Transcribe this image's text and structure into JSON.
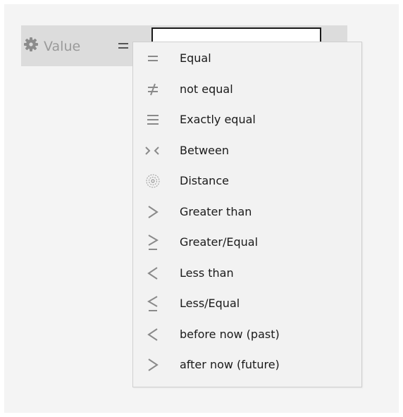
{
  "filter": {
    "field_label": "Value",
    "field_icon": "gear-icon",
    "operator_icon": "equal-icon",
    "input_value": ""
  },
  "operators": [
    {
      "label": "Equal",
      "icon": "equal-icon"
    },
    {
      "label": "not equal",
      "icon": "not-equal-icon"
    },
    {
      "label": "Exactly equal",
      "icon": "exactly-equal-icon"
    },
    {
      "label": "Between",
      "icon": "between-icon"
    },
    {
      "label": "Distance",
      "icon": "distance-icon"
    },
    {
      "label": "Greater than",
      "icon": "greater-than-icon"
    },
    {
      "label": "Greater/Equal",
      "icon": "greater-equal-icon"
    },
    {
      "label": "Less than",
      "icon": "less-than-icon"
    },
    {
      "label": "Less/Equal",
      "icon": "less-equal-icon"
    },
    {
      "label": "before now (past)",
      "icon": "before-now-icon"
    },
    {
      "label": "after now (future)",
      "icon": "after-now-icon"
    }
  ],
  "colors": {
    "panel": "#f4f4f4",
    "filter_row": "#dcdcdc",
    "dropdown": "#f2f2f2",
    "icon": "#8a8a8a",
    "text": "#1a1a1a",
    "muted_text": "#9a9a9a"
  }
}
